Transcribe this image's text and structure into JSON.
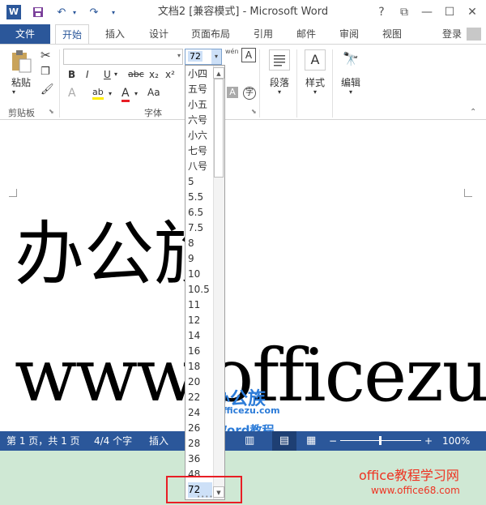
{
  "titlebar": {
    "title": "文档2 [兼容模式] - Microsoft Word",
    "help_label": "?",
    "restore_label": "⧉",
    "minimize_label": "—",
    "maximize_label": "☐",
    "close_label": "✕",
    "word_logo_label": "W"
  },
  "tabs": {
    "file": "文件",
    "items": [
      "开始",
      "插入",
      "设计",
      "页面布局",
      "引用",
      "邮件",
      "审阅",
      "视图"
    ],
    "login": "登录"
  },
  "ribbon": {
    "paste_label": "粘贴",
    "clipboard_label": "剪贴板",
    "font_group_label": "字体",
    "font_size_value": "72",
    "paragraph_label": "段落",
    "styles_label": "样式",
    "editing_label": "编辑",
    "font_name_value": "",
    "wen_label": "wén",
    "font_buttons": [
      "B",
      "I",
      "U",
      "abc",
      "x₂",
      "x²"
    ],
    "font_row3": [
      "A",
      "ab",
      "A",
      "Aa"
    ]
  },
  "document": {
    "line1": "办公族",
    "line2": "www.officezu"
  },
  "statusbar": {
    "page": "第 1 页，共 1 页",
    "words": "4/4 个字",
    "mode": "插入",
    "zoom": "100%",
    "zoom_minus": "−",
    "zoom_plus": "+"
  },
  "font_size_dropdown": {
    "options": [
      "小四",
      "五号",
      "小五",
      "六号",
      "小六",
      "七号",
      "八号",
      "5",
      "5.5",
      "6.5",
      "7.5",
      "8",
      "9",
      "10",
      "10.5",
      "11",
      "12",
      "14",
      "16",
      "18",
      "20",
      "22",
      "24",
      "26",
      "28",
      "36",
      "48",
      "72"
    ],
    "selected": "72"
  },
  "watermarks": {
    "logo": "办公族",
    "site": "Officezu.com",
    "word": "Word教程",
    "bottom_title": "office教程学习网",
    "bottom_url": "www.office68.com"
  }
}
